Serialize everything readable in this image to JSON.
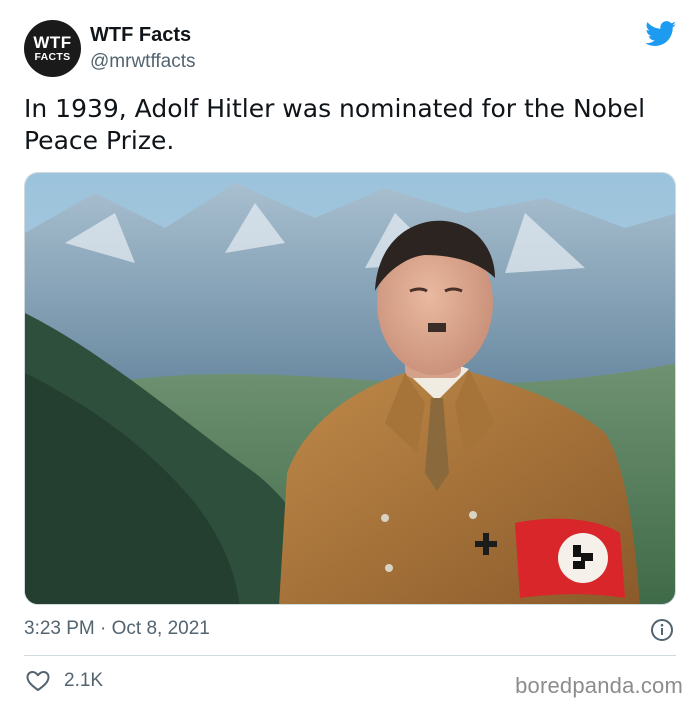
{
  "author": {
    "name": "WTF Facts",
    "handle": "@mrwtffacts",
    "avatar": {
      "line1": "WTF",
      "line2": "FACTS"
    }
  },
  "tweet": {
    "text": "In 1939, Adolf Hitler was nominated for the Nobel Peace Prize."
  },
  "meta": {
    "timestamp": "3:23 PM · Oct 8, 2021"
  },
  "engagement": {
    "likes": "2.1K"
  },
  "watermark": "boredpanda.com",
  "icons": {
    "brand": "twitter-bird-icon",
    "info": "info-icon",
    "like": "heart-icon"
  },
  "colors": {
    "twitter_blue": "#1d9bf0",
    "text_primary": "#0f1419",
    "text_secondary": "#536471",
    "divider": "#cfd9de",
    "armband_red": "#d8262b"
  }
}
